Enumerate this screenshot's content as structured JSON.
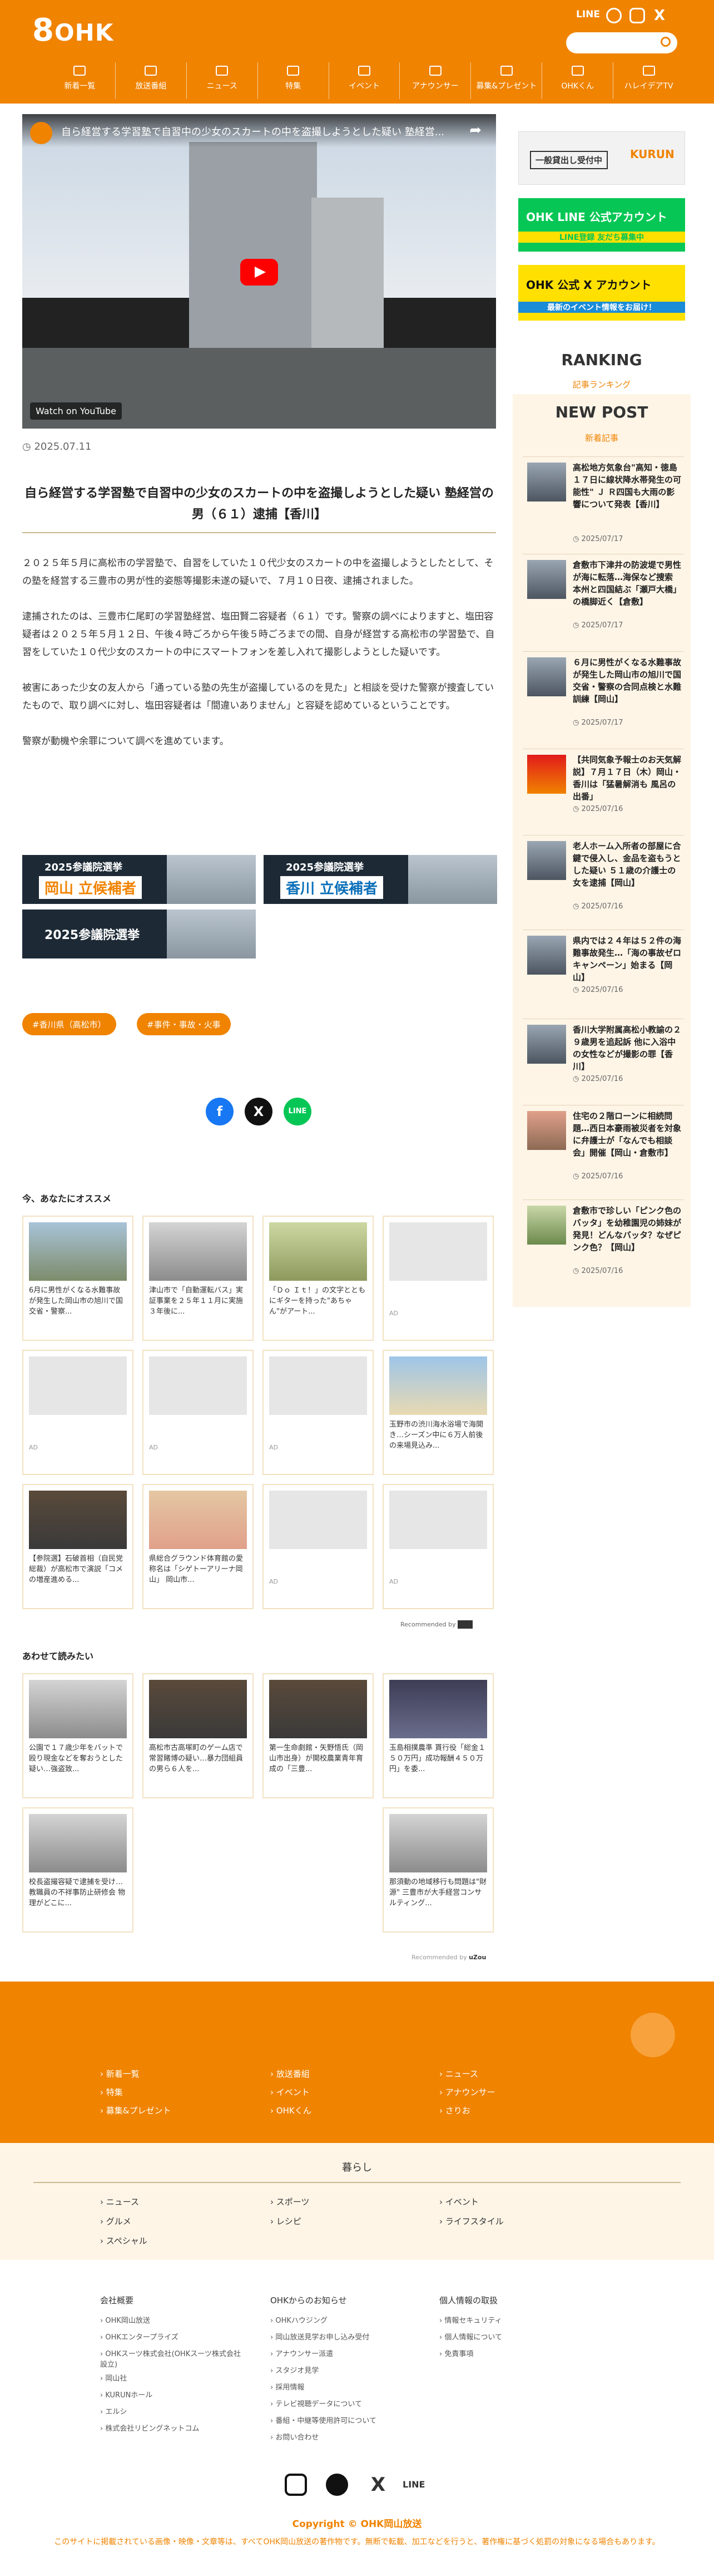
{
  "header": {
    "logo_num": "8",
    "logo_text": "OHK",
    "line_label": "LINE",
    "nav": [
      "新着一覧",
      "放送番組",
      "ニュース",
      "特集",
      "イベント",
      "アナウンサー",
      "募集&プレゼント",
      "OHKくん",
      "ハレイデアTV"
    ]
  },
  "video": {
    "title": "自ら経営する学習塾で自習中の少女のスカートの中を盗撮しようとした疑い 塾経営...",
    "watch_label": "Watch on YouTube"
  },
  "article": {
    "date": "2025.07.11",
    "title": "自ら経営する学習塾で自習中の少女のスカートの中を盗撮しようとした疑い 塾経営の男（６１）逮捕【香川】",
    "paragraphs": [
      "２０２５年５月に高松市の学習塾で、自習をしていた１０代少女のスカートの中を盗撮しようとしたとして、その塾を経営する三豊市の男が性的姿態等撮影未遂の疑いで、７月１０日夜、逮捕されました。",
      "逮捕されたのは、三豊市仁尾町の学習塾経営、塩田賢二容疑者（６１）です。警察の調べによりますと、塩田容疑者は２０２５年５月１２日、午後４時ごろから午後５時ごろまでの間、自身が経営する高松市の学習塾で、自習をしていた１０代少女のスカートの中にスマートフォンを差し入れて撮影しようとした疑いです。",
      "被害にあった少女の友人から「通っている塾の先生が盗撮しているのを見た」と相談を受けた警察が捜査していたもので、取り調べに対し、塩田容疑者は「間違いありません」と容疑を認めているということです。",
      "警察が動機や余罪について調べを進めています。"
    ],
    "banners": [
      {
        "top": "2025参議院選挙",
        "main": "岡山 立候補者"
      },
      {
        "top": "2025参議院選挙",
        "main": "香川 立候補者"
      },
      {
        "top": "",
        "main": "2025参議院選挙"
      }
    ],
    "tags": [
      "#香川県（高松市）",
      "#事件・事故・火事"
    ]
  },
  "recommend": {
    "title": "今、あなたにオススメ",
    "cards": [
      {
        "text": "6月に男性がくなる水難事故が発生した岡山市の旭川で国交省・警察..."
      },
      {
        "text": "津山市で「自動運転バス」実証事業を２５年１１月に実施 ３年後に..."
      },
      {
        "text": "「Ｄｏ Ｉｔ！」の文字とともにギターを持った\"あちゃん\"がアート..."
      },
      {
        "text": "AD"
      },
      {
        "text": "AD"
      },
      {
        "text": "AD"
      },
      {
        "text": "AD"
      },
      {
        "text": "玉野市の渋川海水浴場で海開き…シーズン中に６万人前後の来場見込み..."
      },
      {
        "text": "【参院選】石破首相（自民党総裁）が高松市で演説「コメの増産進める..."
      },
      {
        "text": "県総合グラウンド体育館の愛称名は「シゲトーアリーナ岡山」 岡山市..."
      },
      {
        "text": "AD"
      },
      {
        "text": "AD"
      }
    ],
    "powered": "Recommended by"
  },
  "related": {
    "title": "あわせて読みたい",
    "cards": [
      {
        "text": "公園で１７歳少年をバットで殴り現金などを奪おうとした疑い…強盗致..."
      },
      {
        "text": "高松市古高塚町のゲーム店で常習賭博の疑い…暴力団組員の男ら６人を..."
      },
      {
        "text": "第一生命劇館・矢野悟氏（岡山市出身）が開校農業青年育成の「三豊..."
      },
      {
        "text": "玉島相撲農準 貰行役「総金１５０万円」成功報酬４５０万円」を委..."
      },
      {
        "text": "校長盗撮容疑で逮捕を受け…教職員の不祥事防止研修会 物理がどこに..."
      },
      {
        "text": "那須動の地域移行も問題は\"財源\" 三豊市が大手経営コンサルティング..."
      }
    ],
    "powered": "Recommended by"
  },
  "sidebar": {
    "banner1": "一般貸出し受付中",
    "banner2": "OHK LINE 公式アカウント",
    "banner2_sub": "LINE登録 友だち募集中",
    "banner3": "OHK 公式 X アカウント",
    "banner3_sub": "最新のイベント情報をお届け！",
    "ranking_title": "RANKING",
    "ranking_sub": "記事ランキング",
    "newpost_title": "NEW POST",
    "newpost_sub": "新着記事",
    "items": [
      {
        "title": "高松地方気象台\"高知・徳島１７日に線状降水帯発生の可能性\" Ｊ Ｒ四国も大雨の影響について発表【香川】",
        "date": "2025/07/17"
      },
      {
        "title": "倉敷市下津井の防波堤で男性が海に転落…海保など捜索 本州と四国結ぶ「瀬戸大橋」の橋脚近く【倉敷】",
        "date": "2025/07/17"
      },
      {
        "title": "６月に男性がくなる水難事故が発生した岡山市の旭川で国交省・警察の合同点検と水難訓練【岡山】",
        "date": "2025/07/17"
      },
      {
        "title": "【共同気象予報士のお天気解説】７月１７日（木）岡山・香川は「猛暑解消も 風呂の出番」",
        "date": "2025/07/16"
      },
      {
        "title": "老人ホーム入所者の部屋に合鍵で侵入し、金品を盗もうとした疑い ５１歳の介護士の女を逮捕【岡山】",
        "date": "2025/07/16"
      },
      {
        "title": "県内では２４年は５２件の海難事故発生…「海の事故ゼロキャンペーン」始まる【岡山】",
        "date": "2025/07/16"
      },
      {
        "title": "香川大学附属高松小教諭の２９歳男を追起訴 他に入浴中の女性などが撮影の罪【香川】",
        "date": "2025/07/16"
      },
      {
        "title": "住宅の２階ローンに相続問題…西日本豪雨被災者を対象に弁護士が「なんでも相談会」開催【岡山・倉敷市】",
        "date": "2025/07/16"
      },
      {
        "title": "倉敷市で珍しい「ピンク色のバッタ」を幼稚園児の姉妹が発見！どんなバッタ？なぜピンク色？【岡山】",
        "date": "2025/07/16"
      }
    ]
  },
  "footer": {
    "links": [
      "新着一覧",
      "放送番組",
      "ニュース",
      "特集",
      "イベント",
      "アナウンサー",
      "募集&プレゼント",
      "OHKくん",
      "さりお"
    ],
    "kurashi_title": "暮らし",
    "kurashi_links": [
      "ニュース",
      "スポーツ",
      "イベント",
      "グルメ",
      "レシピ",
      "ライフスタイル",
      "スペシャル"
    ],
    "col1_head": "会社概要",
    "col1": [
      "OHK岡山放送",
      "OHKエンタープライズ",
      "OHKスーツ株式会社(OHKスーツ株式会社設立)",
      "岡山社",
      "KURUNホール",
      "エルシ",
      "株式会社リビングネットコム"
    ],
    "col2_head": "OHKからのお知らせ",
    "col2": [
      "OHKハウジング",
      "岡山放送見学お申し込み受付",
      "アナウンサー派遣",
      "スタジオ見学",
      "採用情報",
      "テレビ視聴データについて",
      "番組・中継等使用許可について",
      "お問い合わせ"
    ],
    "col3_head": "個人情報の取扱",
    "col3": [
      "情報セキュリティ",
      "個人情報について",
      "免責事項"
    ],
    "copyright": "Copyright © OHK岡山放送",
    "note": "このサイトに掲載されている画像・映像・文章等は、すべてOHK岡山放送の著作物です。無断で転載、加工などを行うと、著作権に基づく処罰の対象になる場合もあります。"
  }
}
